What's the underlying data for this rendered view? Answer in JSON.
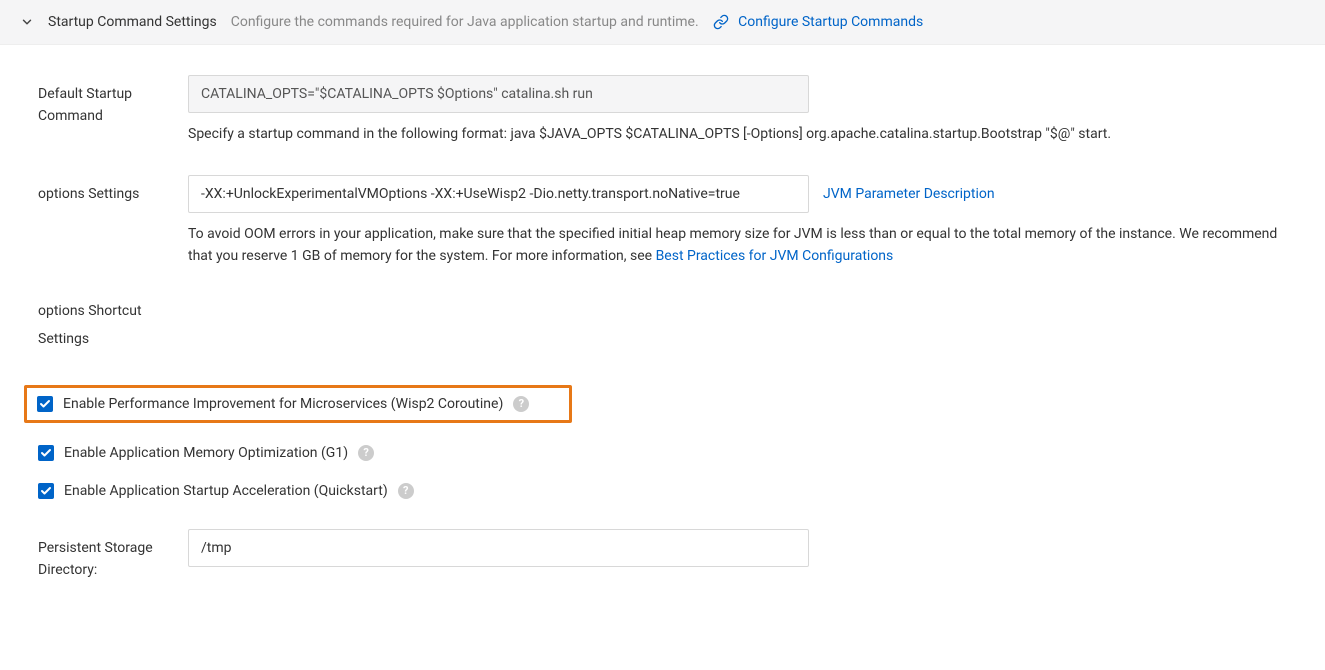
{
  "header": {
    "title": "Startup Command Settings",
    "subtitle": "Configure the commands required for Java application startup and runtime.",
    "configure_link": "Configure Startup Commands"
  },
  "form": {
    "default_startup": {
      "label": "Default Startup Command",
      "value": "CATALINA_OPTS=\"$CATALINA_OPTS $Options\" catalina.sh run",
      "hint": "Specify a startup command in the following format: java $JAVA_OPTS $CATALINA_OPTS [-Options] org.apache.catalina.startup.Bootstrap \"$@\" start."
    },
    "options_settings": {
      "label": "options Settings",
      "value": "-XX:+UnlockExperimentalVMOptions -XX:+UseWisp2 -Dio.netty.transport.noNative=true",
      "side_link": "JVM Parameter Description",
      "hint_prefix": "To avoid OOM errors in your application, make sure that the specified initial heap memory size for JVM is less than or equal to the total memory of the instance. We recommend that you reserve 1 GB of memory for the system. For more information, see ",
      "hint_link": "Best Practices for JVM Configurations"
    },
    "shortcut": {
      "label": "options Shortcut Settings"
    },
    "checkboxes": {
      "wisp2": "Enable Performance Improvement for Microservices (Wisp2 Coroutine)",
      "g1": "Enable Application Memory Optimization (G1)",
      "quickstart": "Enable Application Startup Acceleration (Quickstart)"
    },
    "persistent": {
      "label": "Persistent Storage Directory:",
      "value": "/tmp"
    }
  }
}
